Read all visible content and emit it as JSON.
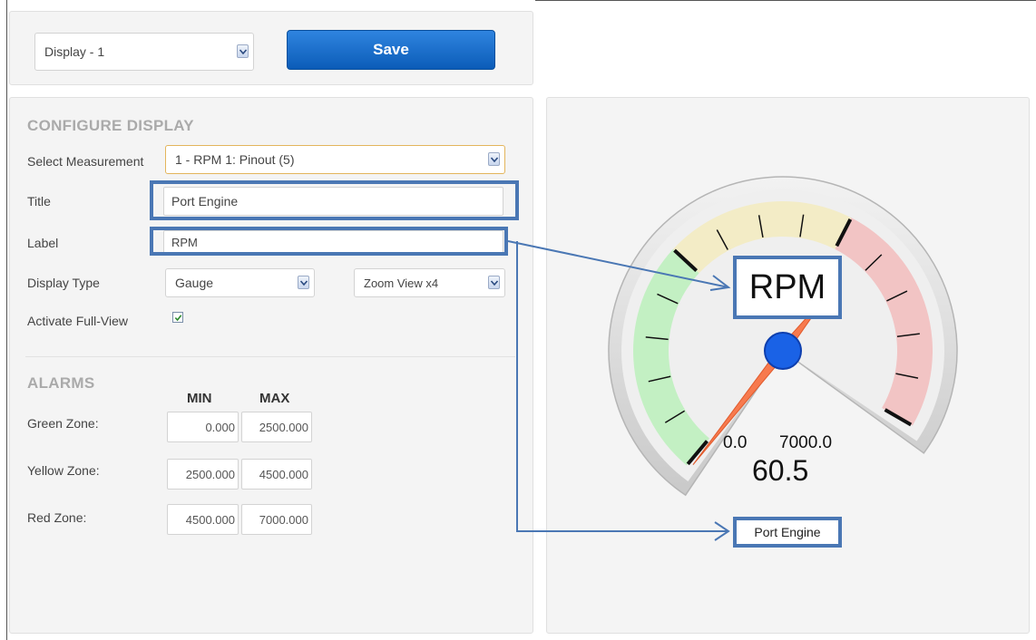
{
  "topbar": {
    "display_select": "Display - 1",
    "save_label": "Save"
  },
  "configure": {
    "heading": "CONFIGURE DISPLAY",
    "measurement_label": "Select Measurement",
    "measurement_value": "1 - RPM 1: Pinout (5)",
    "title_label": "Title",
    "title_value": "Port Engine",
    "label_label": "Label",
    "label_value": "RPM",
    "display_type_label": "Display Type",
    "display_type_value": "Gauge",
    "zoom_value": "Zoom View x4",
    "full_view_label": "Activate Full-View",
    "full_view_checked": true
  },
  "alarms": {
    "heading": "ALARMS",
    "min_header": "MIN",
    "max_header": "MAX",
    "zones": [
      {
        "label": "Green Zone:",
        "min": "0.000",
        "max": "2500.000"
      },
      {
        "label": "Yellow Zone:",
        "min": "2500.000",
        "max": "4500.000"
      },
      {
        "label": "Red Zone:",
        "min": "4500.000",
        "max": "7000.000"
      }
    ]
  },
  "gauge": {
    "label": "RPM",
    "title": "Port Engine",
    "min_text": "0.0",
    "max_text": "7000.0",
    "value_text": "60.5",
    "min": 0,
    "max": 7000,
    "value": 60.5,
    "zone_colors": {
      "green": "#c3f0c3",
      "yellow": "#f3ecc6",
      "red": "#f2c4c4"
    },
    "needle_color": "#f77a4e",
    "hub_color": "#1a62e6",
    "highlight_color": "#4a77b4"
  }
}
